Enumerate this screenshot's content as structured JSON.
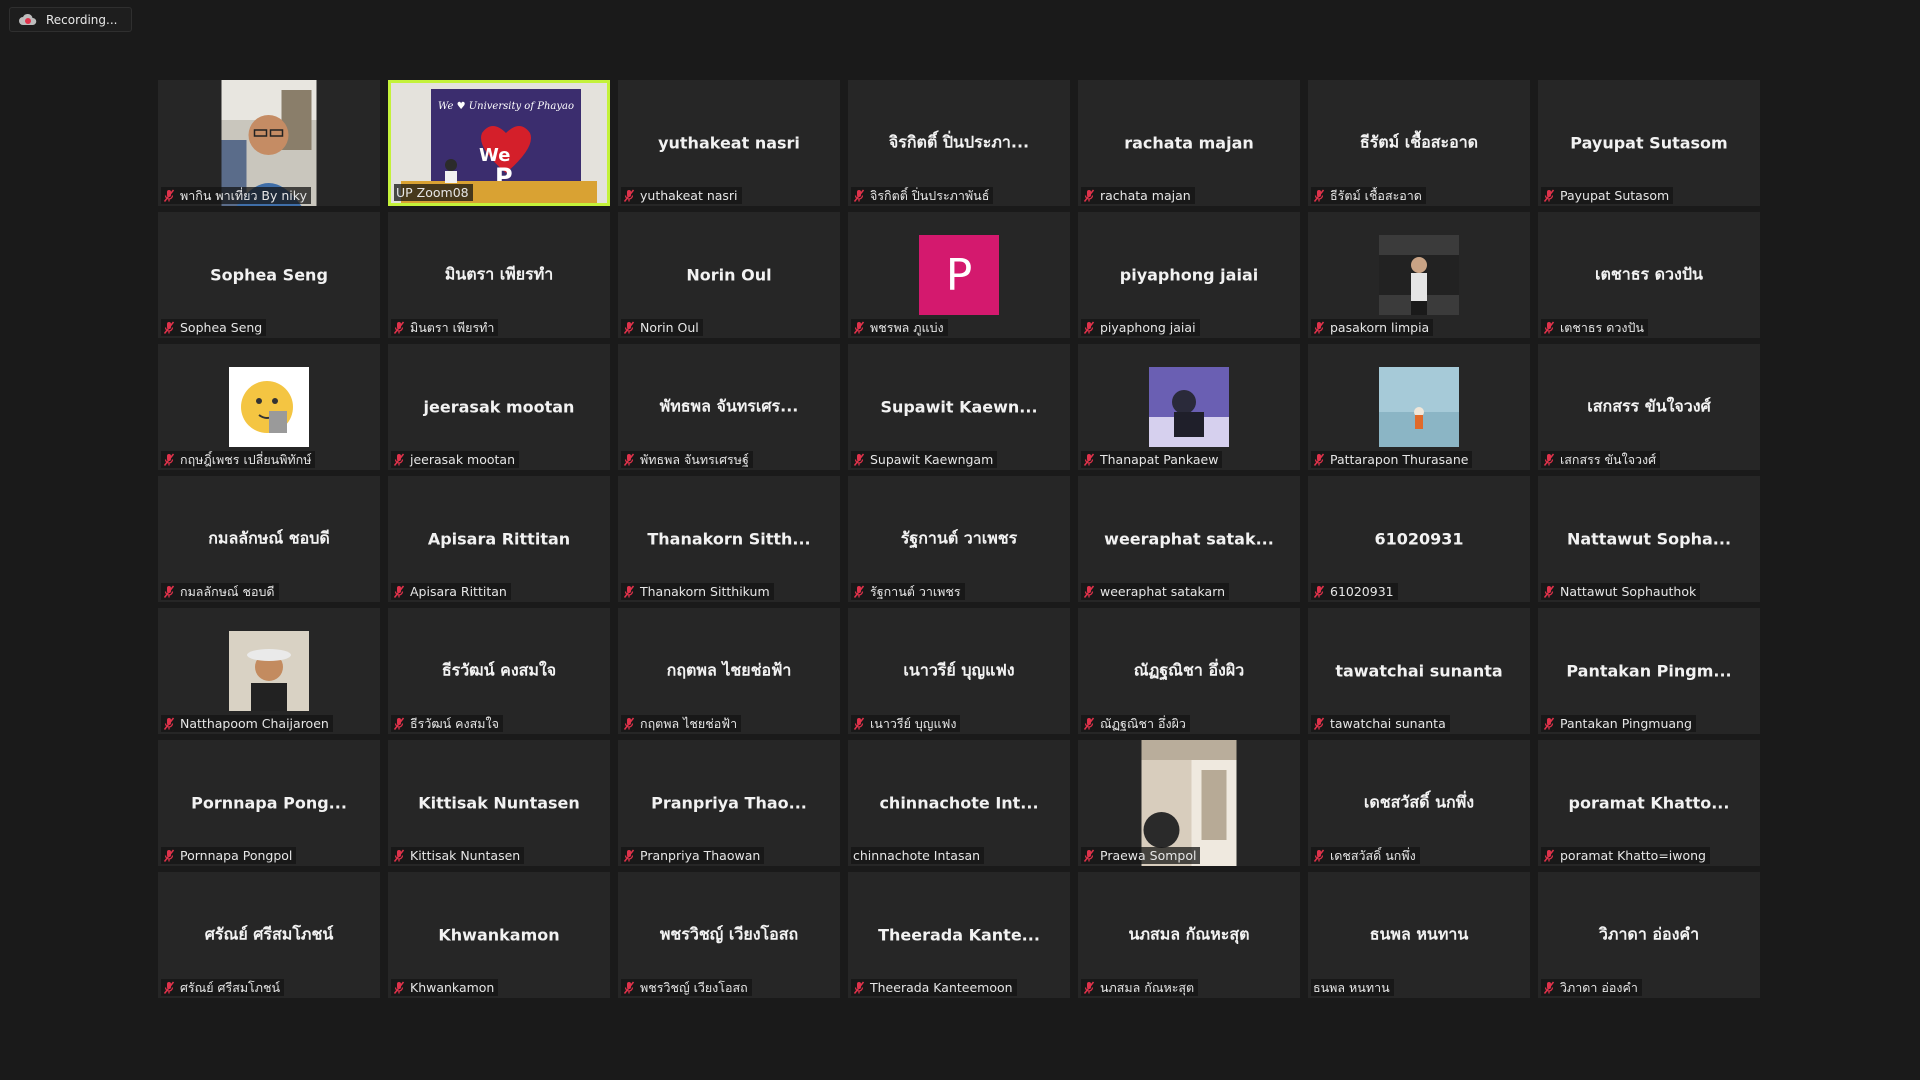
{
  "recording": {
    "label": "Recording...",
    "icon": "cloud-recording-icon"
  },
  "participants": [
    {
      "display": "",
      "label": "พากิน พาเที่ยว By niky",
      "muted": true,
      "type": "photo",
      "photo": "man-glasses"
    },
    {
      "display": "",
      "label": "UP Zoom08",
      "muted": false,
      "type": "video",
      "active": true
    },
    {
      "display": "yuthakeat nasri",
      "label": "yuthakeat nasri",
      "muted": true,
      "type": "name"
    },
    {
      "display": "จิรกิตติ์ ปิ่นประภา...",
      "label": "จิรกิตติ์ ปิ่นประภาพันธ์",
      "muted": true,
      "type": "name"
    },
    {
      "display": "rachata majan",
      "label": "rachata majan",
      "muted": true,
      "type": "name"
    },
    {
      "display": "ธีรัตม์ เชื้อสะอาด",
      "label": "ธีรัตม์ เชื้อสะอาด",
      "muted": true,
      "type": "name"
    },
    {
      "display": "Payupat Sutasom",
      "label": "Payupat Sutasom",
      "muted": true,
      "type": "name"
    },
    {
      "display": "Sophea Seng",
      "label": "Sophea Seng",
      "muted": true,
      "type": "name"
    },
    {
      "display": "มินตรา เพียรทำ",
      "label": "มินตรา เพียรทำ",
      "muted": true,
      "type": "name"
    },
    {
      "display": "Norin Oul",
      "label": "Norin Oul",
      "muted": true,
      "type": "name"
    },
    {
      "display": "",
      "label": "พชรพล ภูแบ่ง",
      "muted": true,
      "type": "letter",
      "letter": "P"
    },
    {
      "display": "piyaphong jaiai",
      "label": "piyaphong jaiai",
      "muted": true,
      "type": "name"
    },
    {
      "display": "",
      "label": "pasakorn limpia",
      "muted": true,
      "type": "photo",
      "photo": "car-person"
    },
    {
      "display": "เตชาธร ดวงปัน",
      "label": "เตชาธร ดวงปัน",
      "muted": true,
      "type": "name"
    },
    {
      "display": "",
      "label": "กฤษฎิ์เพชร เปลี่ยนพิทักษ์",
      "muted": true,
      "type": "photo",
      "photo": "emoji"
    },
    {
      "display": "jeerasak mootan",
      "label": "jeerasak mootan",
      "muted": true,
      "type": "name"
    },
    {
      "display": "พัทธพล จันทรเศร...",
      "label": "พัทธพล จันทรเศรษฐ์",
      "muted": true,
      "type": "name"
    },
    {
      "display": "Supawit  Kaewn...",
      "label": "Supawit Kaewngam",
      "muted": true,
      "type": "name"
    },
    {
      "display": "",
      "label": "Thanapat Pankaew",
      "muted": true,
      "type": "photo",
      "photo": "purple-person"
    },
    {
      "display": "",
      "label": "Pattarapon Thurasane",
      "muted": true,
      "type": "photo",
      "photo": "sea"
    },
    {
      "display": "เสกสรร ขันใจวงศ์",
      "label": "เสกสรร ขันใจวงศ์",
      "muted": true,
      "type": "name"
    },
    {
      "display": "กมลลักษณ์ ชอบดี",
      "label": "กมลลักษณ์ ชอบดี",
      "muted": true,
      "type": "name"
    },
    {
      "display": "Apisara Rittitan",
      "label": "Apisara Rittitan",
      "muted": true,
      "type": "name"
    },
    {
      "display": "Thanakorn  Sitth...",
      "label": "Thanakorn Sitthikum",
      "muted": true,
      "type": "name"
    },
    {
      "display": "รัฐกานต์ วาเพชร",
      "label": "รัฐกานต์ วาเพชร",
      "muted": true,
      "type": "name"
    },
    {
      "display": "weeraphat  satak...",
      "label": "weeraphat satakarn",
      "muted": true,
      "type": "name"
    },
    {
      "display": "61020931",
      "label": "61020931",
      "muted": true,
      "type": "name"
    },
    {
      "display": "Nattawut  Sopha...",
      "label": "Nattawut Sophauthok",
      "muted": true,
      "type": "name"
    },
    {
      "display": "",
      "label": "Natthapoom Chaijaroen",
      "muted": true,
      "type": "photo",
      "photo": "hat-man"
    },
    {
      "display": "ธีรวัฒน์ คงสมใจ",
      "label": "ธีรวัฒน์ คงสมใจ",
      "muted": true,
      "type": "name"
    },
    {
      "display": "กฤตพล ไชยช่อฟ้า",
      "label": "กฤตพล ไชยช่อฟ้า",
      "muted": true,
      "type": "name"
    },
    {
      "display": "เนาวรีย์ บุญแฟง",
      "label": "เนาวรีย์ บุญแฟง",
      "muted": true,
      "type": "name"
    },
    {
      "display": "ณัฏฐณิชา อึ่งผิว",
      "label": "ณัฏฐณิชา อึ่งผิว",
      "muted": true,
      "type": "name"
    },
    {
      "display": "tawatchai sunanta",
      "label": "tawatchai sunanta",
      "muted": true,
      "type": "name"
    },
    {
      "display": "Pantakan  Pingm...",
      "label": "Pantakan Pingmuang",
      "muted": true,
      "type": "name"
    },
    {
      "display": "Pornnapa  Pong...",
      "label": "Pornnapa Pongpol",
      "muted": true,
      "type": "name"
    },
    {
      "display": "Kittisak Nuntasen",
      "label": "Kittisak Nuntasen",
      "muted": true,
      "type": "name"
    },
    {
      "display": "Pranpriya  Thao...",
      "label": "Pranpriya Thaowan",
      "muted": true,
      "type": "name"
    },
    {
      "display": "chinnachote  Int...",
      "label": "chinnachote Intasan",
      "muted": false,
      "type": "name"
    },
    {
      "display": "",
      "label": "Praewa Sompol",
      "muted": true,
      "type": "photo",
      "photo": "room"
    },
    {
      "display": "เดชสวัสดิ์ นกพึ่ง",
      "label": "เดชสวัสดิ์ นกพึ่ง",
      "muted": true,
      "type": "name"
    },
    {
      "display": "poramat  Khatto...",
      "label": "poramat Khatto=iwong",
      "muted": true,
      "type": "name"
    },
    {
      "display": "ศรัณย์ ศรีสมโภชน์",
      "label": "ศรัณย์ ศรีสมโภชน์",
      "muted": true,
      "type": "name"
    },
    {
      "display": "Khwankamon",
      "label": "Khwankamon",
      "muted": true,
      "type": "name"
    },
    {
      "display": "พชรวิชญ์ เวียงโอสถ",
      "label": "พชรวิชญ์ เวียงโอสถ",
      "muted": true,
      "type": "name"
    },
    {
      "display": "Theerada  Kante...",
      "label": "Theerada Kanteemoon",
      "muted": true,
      "type": "name"
    },
    {
      "display": "นภสมล กัณหะสุต",
      "label": "นภสมล กัณหะสุต",
      "muted": true,
      "type": "name"
    },
    {
      "display": "ธนพล หนทาน",
      "label": "ธนพล หนทาน",
      "muted": false,
      "type": "name"
    },
    {
      "display": "วิภาดา อ่องคำ",
      "label": "วิภาดา อ่องคำ",
      "muted": true,
      "type": "name"
    }
  ],
  "active_video": {
    "banner_text": "We ♥ University of Phayao",
    "overlay": "We",
    "letter": "P"
  },
  "colors": {
    "background": "#1a1a1a",
    "tile": "#262626",
    "active_border": "#c4f23a",
    "muted_icon": "#e0324b"
  }
}
